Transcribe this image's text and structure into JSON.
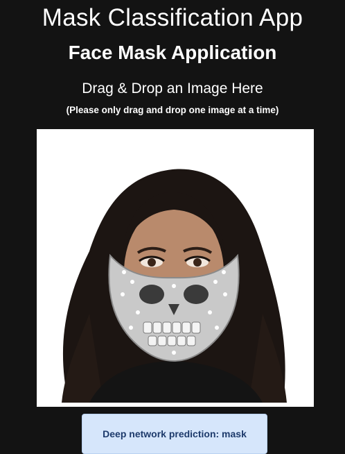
{
  "app": {
    "title": "Mask Classification App",
    "subtitle": "Face Mask Application"
  },
  "dropzone": {
    "heading": "Drag & Drop an Image Here",
    "note": "(Please only drag and drop one image at a time)",
    "image_description_icon": "photo-of-woman-wearing-jeweled-skull-mask"
  },
  "result": {
    "prediction_text": "Deep network prediction: mask"
  },
  "colors": {
    "background": "#131313",
    "text": "#ffffff",
    "result_bg": "#d6e6fb",
    "result_text": "#1d3a6b"
  }
}
